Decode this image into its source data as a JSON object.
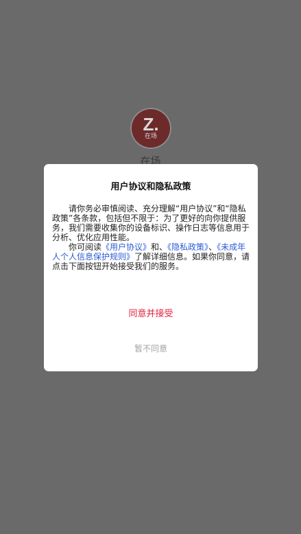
{
  "background": {
    "logo_letter": "Z.",
    "logo_subtext": "在场",
    "app_name": "在场"
  },
  "dialog": {
    "title": "用户协议和隐私政策",
    "paragraph1": "请你务必审慎阅读、充分理解“用户协议”和“隐私政策”各条款，包括但不限于：为了更好的向你提供服务，我们需要收集你的设备标识、操作日志等信息用于分析、优化应用性能。",
    "paragraph2_prefix": "你可阅读",
    "link_user_agreement": "《用户协议》",
    "and_text": "和、",
    "link_privacy_policy": "《隐私政策》",
    "sep_text": "、",
    "link_minor_rules": "《未成年人个人信息保护规则》",
    "paragraph2_suffix": "了解详细信息。如果你同意，请点击下面按钮开始接受我们的服务。",
    "agree_label": "同意并接受",
    "disagree_label": "暂不同意"
  },
  "colors": {
    "overlay": "#6a6a6a",
    "agree": "#e2213c",
    "link": "#2b5bd7",
    "disagree": "#a3a3a3"
  }
}
